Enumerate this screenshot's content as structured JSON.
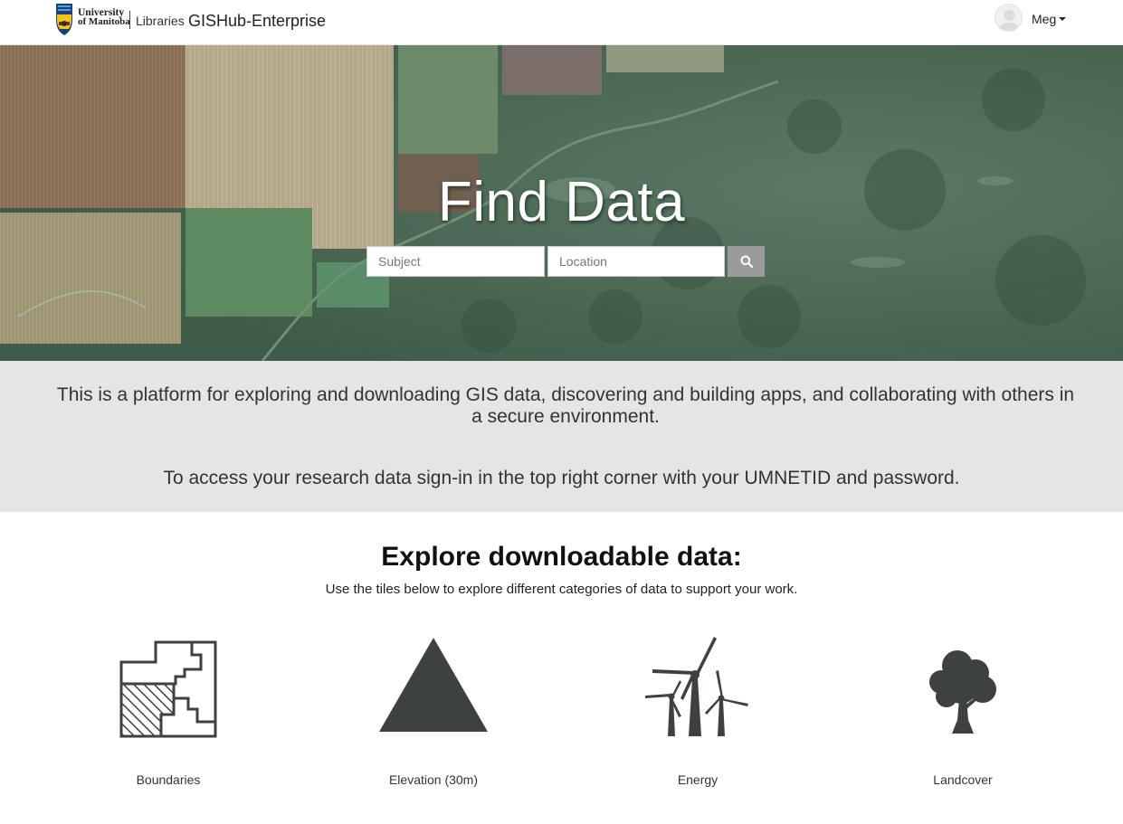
{
  "header": {
    "logo_university": "University",
    "logo_of_manitoba": "of Manitoba",
    "libraries": "Libraries",
    "app_title": "GISHub-Enterprise",
    "username": "Meg"
  },
  "hero": {
    "title": "Find Data",
    "subject_placeholder": "Subject",
    "location_placeholder": "Location",
    "search_icon": "search-icon"
  },
  "intro": {
    "paragraph1": "This is a platform for exploring and downloading GIS data, discovering and building apps, and collaborating with others in a secure environment.",
    "paragraph2": "To access your research data sign-in in the top right corner with your UMNETID and password."
  },
  "explore": {
    "title": "Explore downloadable data:",
    "subtitle": "Use the tiles below to explore different categories of data to support your work.",
    "tiles": [
      {
        "label": "Boundaries",
        "icon": "boundaries-icon"
      },
      {
        "label": "Elevation (30m)",
        "icon": "elevation-icon"
      },
      {
        "label": "Energy",
        "icon": "wind-turbine-icon"
      },
      {
        "label": "Landcover",
        "icon": "tree-icon"
      }
    ]
  },
  "colors": {
    "icon_fill": "#3d4240",
    "intro_band": "#e4e5e6",
    "search_button": "#9b9b9b"
  }
}
